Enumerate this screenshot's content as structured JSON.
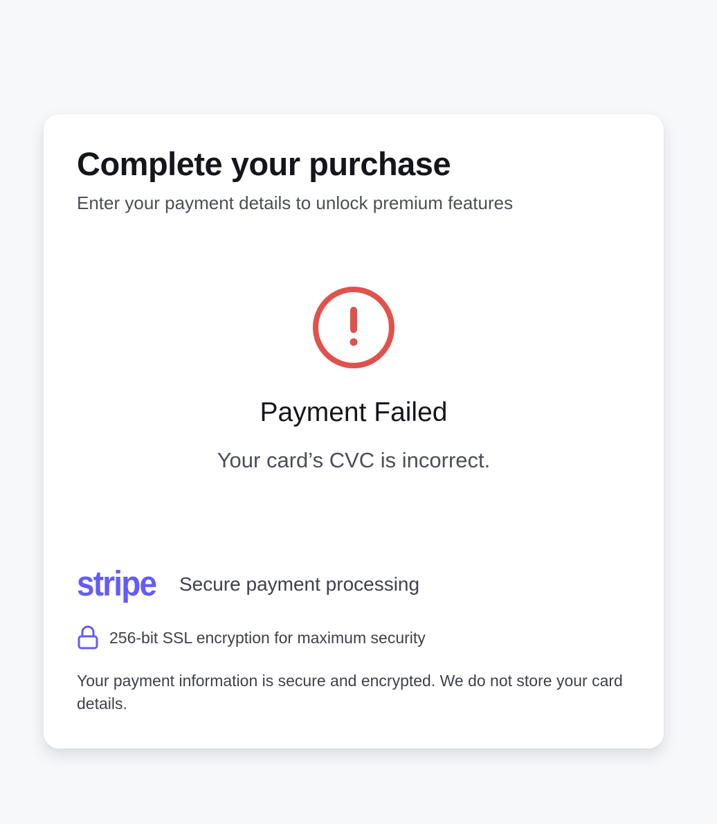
{
  "header": {
    "title": "Complete your purchase",
    "subtitle": "Enter your payment details to unlock premium features"
  },
  "error": {
    "icon": "alert-circle-icon",
    "title": "Payment Failed",
    "message": "Your card’s CVC is incorrect.",
    "color": "#e0524c"
  },
  "footer": {
    "stripe_logo": "stripe",
    "stripe_caption": "Secure payment processing",
    "ssl_icon": "lock-icon",
    "ssl_text": "256-bit SSL encryption for maximum security",
    "note": "Your payment information is secure and encrypted. We do not store your card details.",
    "brand_color": "#635bff"
  }
}
